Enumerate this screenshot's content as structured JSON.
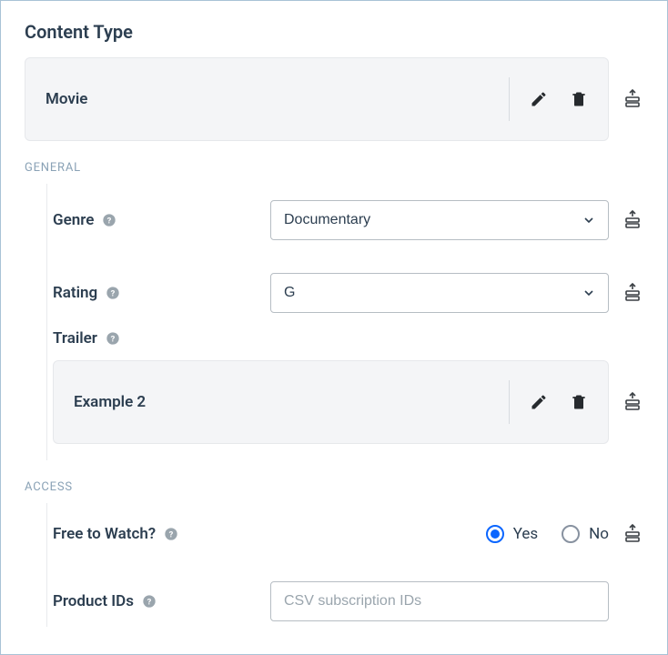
{
  "title": "Content Type",
  "content_type": {
    "value": "Movie"
  },
  "sections": {
    "general_label": "GENERAL",
    "access_label": "ACCESS"
  },
  "general": {
    "genre": {
      "label": "Genre",
      "value": "Documentary"
    },
    "rating": {
      "label": "Rating",
      "value": "G"
    },
    "trailer": {
      "label": "Trailer",
      "value": "Example 2"
    }
  },
  "access": {
    "free_to_watch": {
      "label": "Free to Watch?",
      "yes_label": "Yes",
      "no_label": "No",
      "value": "yes"
    },
    "product_ids": {
      "label": "Product IDs",
      "placeholder": "CSV subscription IDs",
      "value": ""
    }
  }
}
